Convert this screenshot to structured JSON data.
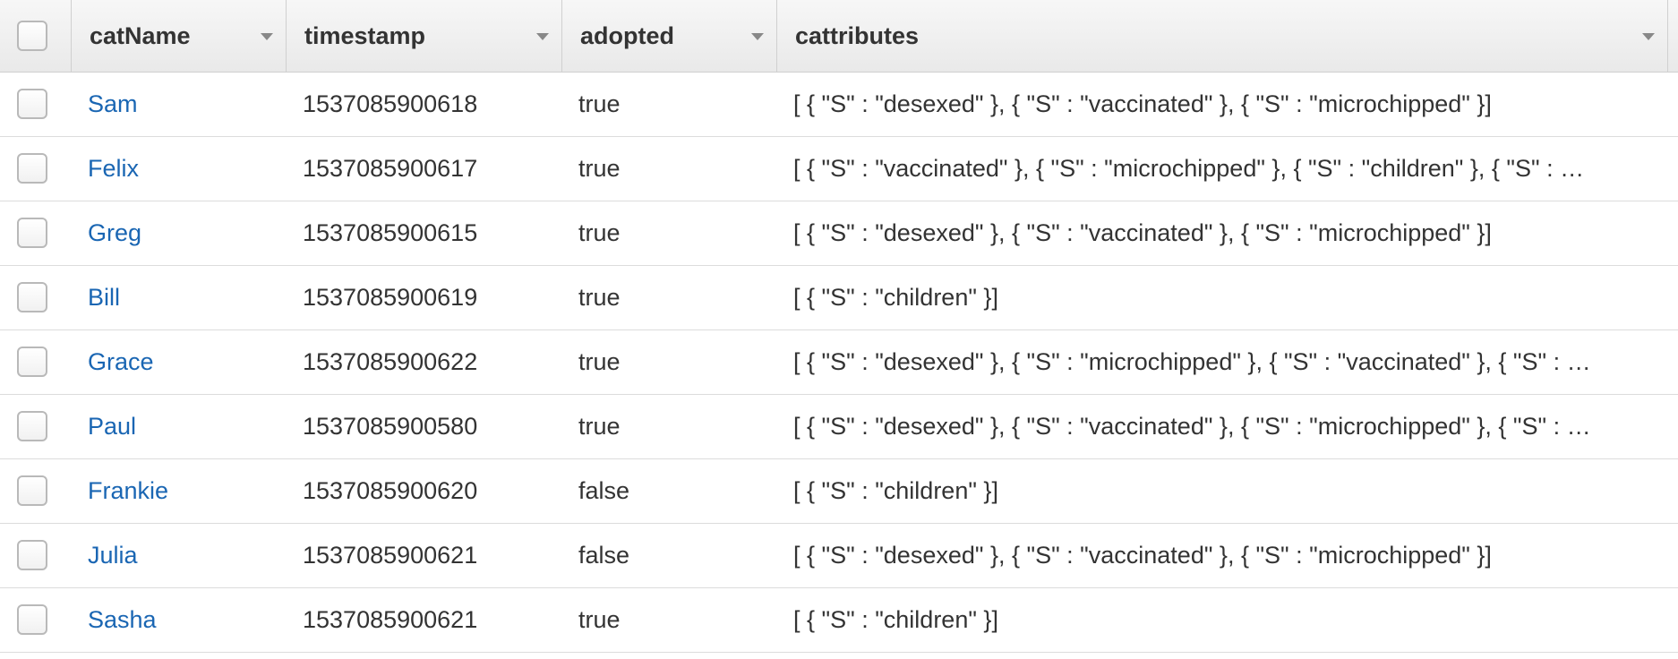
{
  "table": {
    "columns": [
      {
        "key": "catName",
        "label": "catName"
      },
      {
        "key": "timestamp",
        "label": "timestamp"
      },
      {
        "key": "adopted",
        "label": "adopted"
      },
      {
        "key": "cattributes",
        "label": "cattributes"
      }
    ],
    "rows": [
      {
        "catName": "Sam",
        "timestamp": "1537085900618",
        "adopted": "true",
        "cattributes": "[ { \"S\" : \"desexed\" }, { \"S\" : \"vaccinated\" }, { \"S\" : \"microchipped\" }]"
      },
      {
        "catName": "Felix",
        "timestamp": "1537085900617",
        "adopted": "true",
        "cattributes": "[ { \"S\" : \"vaccinated\" }, { \"S\" : \"microchipped\" }, { \"S\" : \"children\" }, { \"S\" : …"
      },
      {
        "catName": "Greg",
        "timestamp": "1537085900615",
        "adopted": "true",
        "cattributes": "[ { \"S\" : \"desexed\" }, { \"S\" : \"vaccinated\" }, { \"S\" : \"microchipped\" }]"
      },
      {
        "catName": "Bill",
        "timestamp": "1537085900619",
        "adopted": "true",
        "cattributes": "[ { \"S\" : \"children\" }]"
      },
      {
        "catName": "Grace",
        "timestamp": "1537085900622",
        "adopted": "true",
        "cattributes": "[ { \"S\" : \"desexed\" }, { \"S\" : \"microchipped\" }, { \"S\" : \"vaccinated\" }, { \"S\" : …"
      },
      {
        "catName": "Paul",
        "timestamp": "1537085900580",
        "adopted": "true",
        "cattributes": "[ { \"S\" : \"desexed\" }, { \"S\" : \"vaccinated\" }, { \"S\" : \"microchipped\" }, { \"S\" : …"
      },
      {
        "catName": "Frankie",
        "timestamp": "1537085900620",
        "adopted": "false",
        "cattributes": "[ { \"S\" : \"children\" }]"
      },
      {
        "catName": "Julia",
        "timestamp": "1537085900621",
        "adopted": "false",
        "cattributes": "[ { \"S\" : \"desexed\" }, { \"S\" : \"vaccinated\" }, { \"S\" : \"microchipped\" }]"
      },
      {
        "catName": "Sasha",
        "timestamp": "1537085900621",
        "adopted": "true",
        "cattributes": "[ { \"S\" : \"children\" }]"
      }
    ]
  },
  "icons": {
    "sort": "chevron-down-icon",
    "select": "checkbox-icon"
  },
  "colors": {
    "link": "#1a66b3",
    "header_bg": "#ececec",
    "row_border": "#dcdcdc"
  }
}
